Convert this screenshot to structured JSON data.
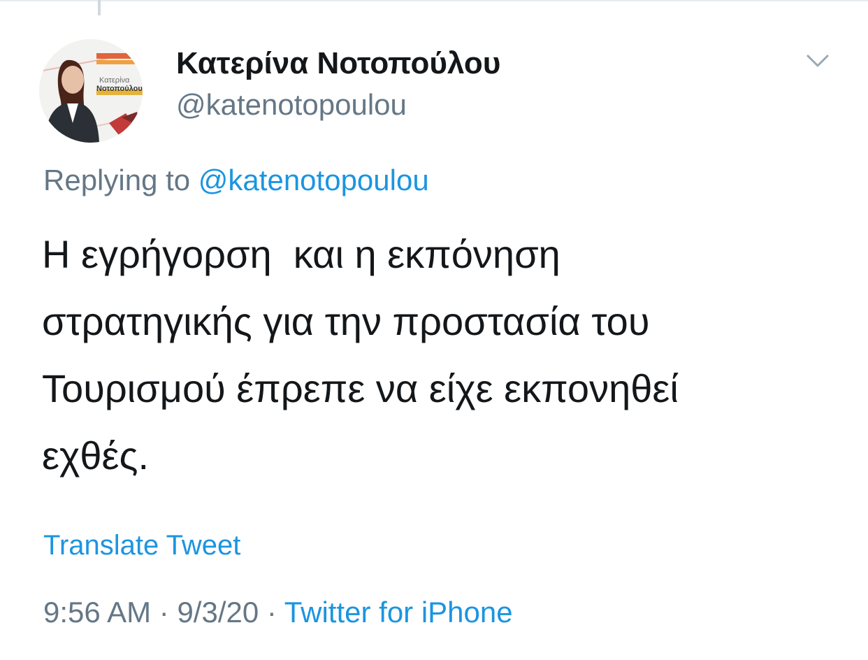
{
  "thread": {
    "has_parent": true
  },
  "author": {
    "name": "Κατερίνα Νοτοπούλου",
    "handle": "@katenotopoulou",
    "avatar": {
      "logo_first": "Κατερίνα",
      "logo_last": "Νοτοπούλου"
    }
  },
  "menu": {
    "icon": "chevron-down-icon"
  },
  "reply": {
    "prefix": "Replying to",
    "mention": "@katenotopoulou"
  },
  "tweet": {
    "text": "Η εγρήγορση  και η εκπόνηση\nστρατηγικής για την προστασία του\nΤουρισμού έπρεπε να είχε εκπονηθεί\nεχθές."
  },
  "translate_label": "Translate Tweet",
  "meta": {
    "time": "9:56 AM",
    "separator1": " · ",
    "date": "9/3/20",
    "separator2": " · ",
    "source": "Twitter for iPhone"
  },
  "colors": {
    "text": "#14171a",
    "secondary": "#657786",
    "link": "#1b95e0"
  }
}
